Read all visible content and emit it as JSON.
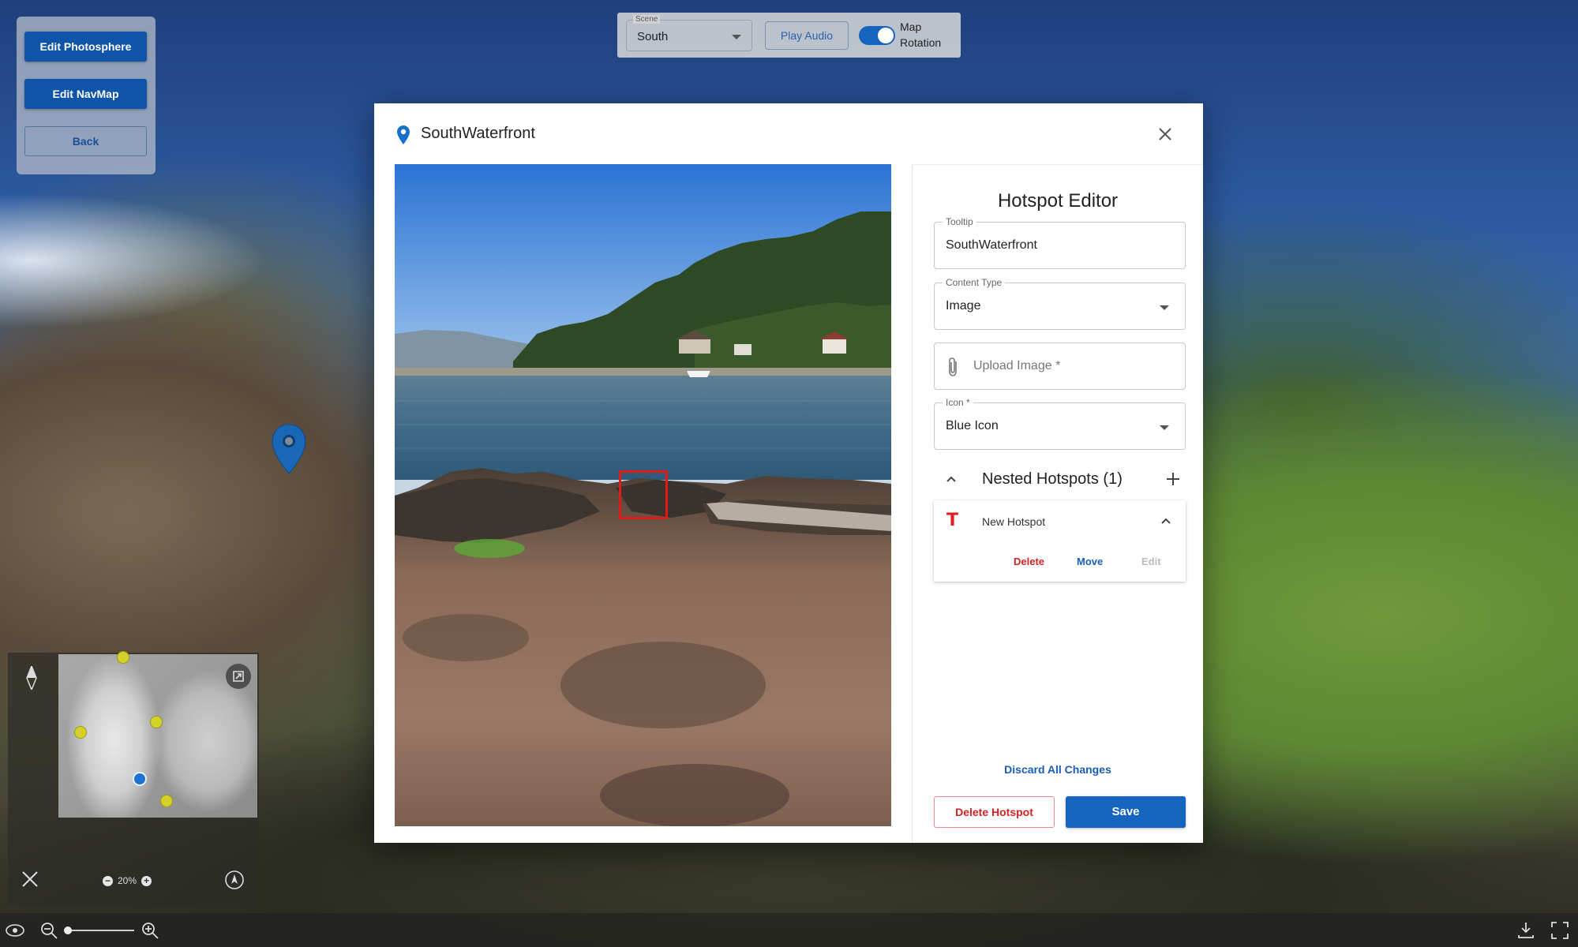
{
  "edit_panel": {
    "edit_photosphere": "Edit Photosphere",
    "edit_navmap": "Edit NavMap",
    "back": "Back"
  },
  "scene_bar": {
    "scene_label": "Scene",
    "scene_value": "South",
    "play_audio": "Play Audio",
    "map_rotation_label": "Map Rotation",
    "map_rotation_on": true
  },
  "minimap": {
    "zoom_level": "20%"
  },
  "modal": {
    "title": "SouthWaterfront",
    "editor": {
      "heading": "Hotspot Editor",
      "tooltip_label": "Tooltip",
      "tooltip_value": "SouthWaterfront",
      "content_type_label": "Content Type",
      "content_type_value": "Image",
      "upload_placeholder": "Upload Image *",
      "icon_label": "Icon *",
      "icon_value": "Blue Icon",
      "nested_title": "Nested Hotspots (1)",
      "nested_items": [
        {
          "name": "New Hotspot",
          "icon_glyph": "T",
          "delete_label": "Delete",
          "move_label": "Move",
          "edit_label": "Edit"
        }
      ],
      "discard_label": "Discard All Changes",
      "delete_hotspot_label": "Delete Hotspot",
      "save_label": "Save"
    }
  },
  "colors": {
    "primary": "#1565c0",
    "danger": "#d42323",
    "selection_box": "#e11a1a"
  }
}
